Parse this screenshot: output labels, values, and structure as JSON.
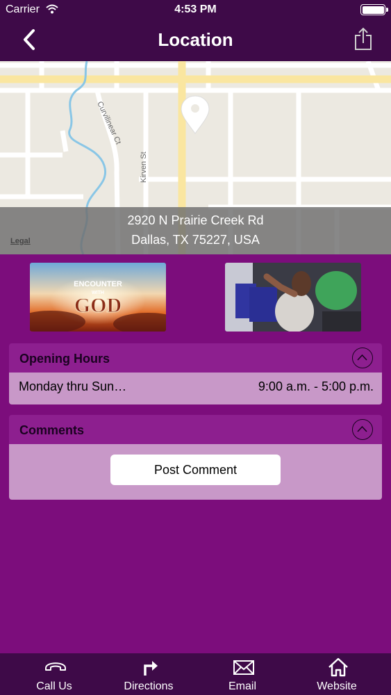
{
  "status": {
    "carrier": "Carrier",
    "time": "4:53 PM"
  },
  "nav": {
    "title": "Location",
    "back_icon": "chevron-left-icon",
    "share_icon": "share-icon"
  },
  "map": {
    "address_line1": "2920 N Prairie Creek Rd",
    "address_line2": "Dallas, TX 75227, USA",
    "legal": "Legal",
    "street_labels": [
      "Curvilinear Ct",
      "Kirven St"
    ]
  },
  "images": {
    "first_caption": "ENCOUNTER WITH GOD"
  },
  "opening_hours": {
    "title": "Opening Hours",
    "day": "Monday thru Sun…",
    "hours": "9:00 a.m. - 5:00 p.m."
  },
  "comments": {
    "title": "Comments",
    "post_label": "Post Comment"
  },
  "tabs": [
    {
      "label": "Call Us",
      "icon": "phone-icon"
    },
    {
      "label": "Directions",
      "icon": "directions-arrow-icon"
    },
    {
      "label": "Email",
      "icon": "envelope-icon"
    },
    {
      "label": "Website",
      "icon": "home-icon"
    }
  ],
  "colors": {
    "bar": "#3e0a48",
    "background": "#7c0d7c",
    "panel_head": "#8d1f8f",
    "panel_body": "#c898c8"
  }
}
